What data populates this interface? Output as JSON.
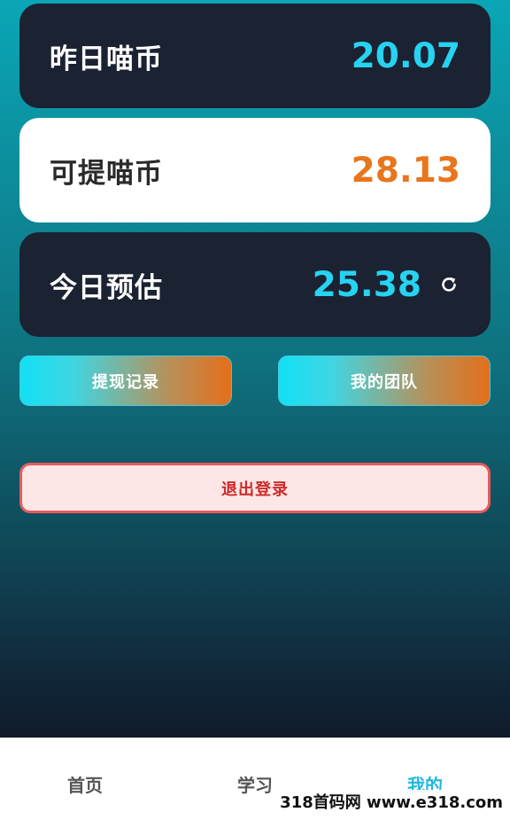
{
  "cards": [
    {
      "label": "昨日喵币",
      "value": "20.07",
      "value_color": "#26d3f1"
    },
    {
      "label": "可提喵币",
      "value": "28.13",
      "value_color": "#e8761c"
    },
    {
      "label": "今日预估",
      "value": "25.38",
      "value_color": "#26d3f1",
      "icon": "refresh-icon"
    }
  ],
  "actions": {
    "withdraw_records_label": "提现记录",
    "my_team_label": "我的团队"
  },
  "logout": {
    "label": "退出登录"
  },
  "tabbar": {
    "items": [
      {
        "label": "首页",
        "active": false
      },
      {
        "label": "学习",
        "active": false
      },
      {
        "label": "我的",
        "active": true
      }
    ],
    "active_color": "#22b8df"
  },
  "watermark": {
    "text": "318首码网 www.e318.com"
  }
}
